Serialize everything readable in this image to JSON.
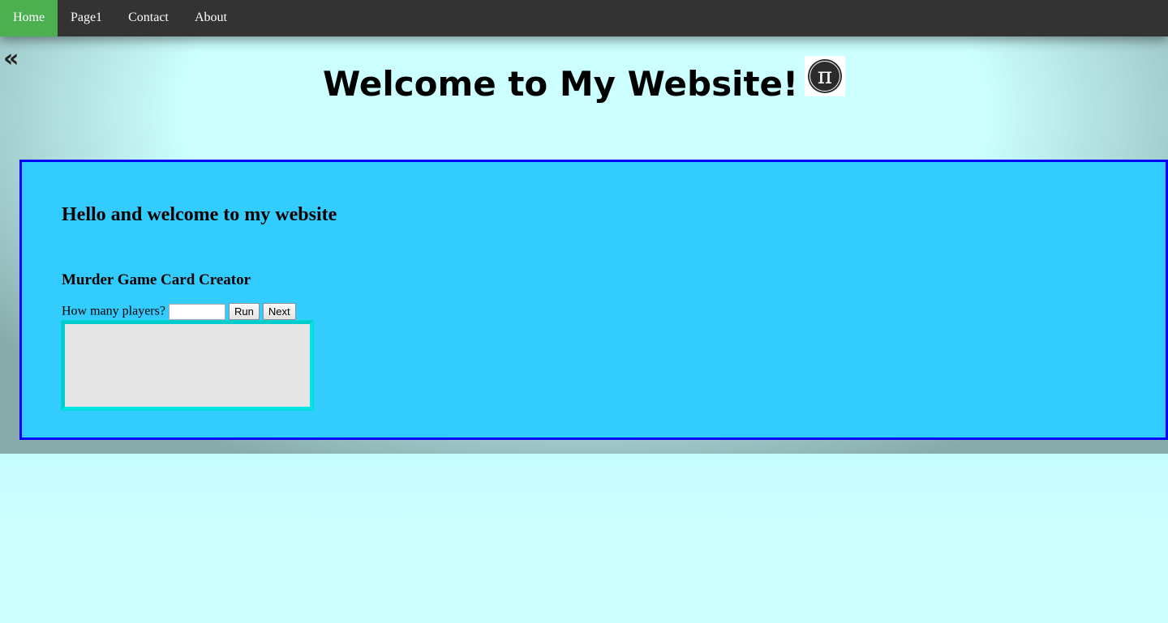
{
  "nav": {
    "items": [
      {
        "label": "Home",
        "active": true
      },
      {
        "label": "Page1",
        "active": false
      },
      {
        "label": "Contact",
        "active": false
      },
      {
        "label": "About",
        "active": false
      }
    ],
    "active_color": "#4caf50",
    "background_color": "#333333"
  },
  "sidebar_toggle": {
    "glyph": "«",
    "icon": "double-chevron-left-icon"
  },
  "header": {
    "title": "Welcome to My Website!",
    "logo": {
      "glyph": "π",
      "icon": "pi-logo-icon"
    }
  },
  "main": {
    "greeting": "Hello and welcome to my website",
    "game": {
      "title": "Murder Game Card Creator",
      "players_label": "How many players?",
      "players_value": "",
      "run_label": "Run",
      "next_label": "Next",
      "output_text": ""
    },
    "panel_color": "#33ccff",
    "border_color": "#0000ff"
  },
  "page_background": "#ccffff"
}
